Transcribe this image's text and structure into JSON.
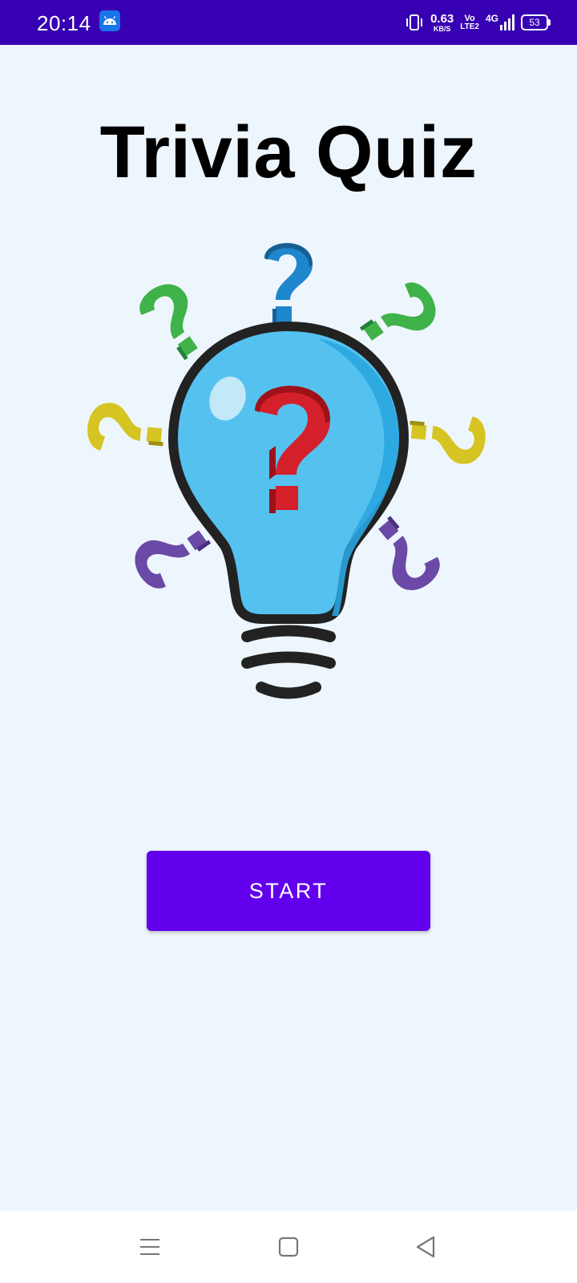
{
  "status_bar": {
    "time": "20:14",
    "net_speed_value": "0.63",
    "net_speed_unit": "KB/S",
    "volte_top": "Vo",
    "volte_bottom": "LTE2",
    "network_type": "4G",
    "battery_level": "53",
    "background_color": "#3700b3",
    "icons": [
      "android-notification-icon",
      "vibrate-icon",
      "signal-icon",
      "battery-icon"
    ]
  },
  "main": {
    "title": "Trivia Quiz",
    "illustration": "lightbulb-question-marks",
    "start_label": "START",
    "accent_color": "#6200ee",
    "background_color": "#eef6fd"
  },
  "nav_bar": {
    "icons": [
      "menu-icon",
      "home-icon",
      "back-icon"
    ]
  }
}
